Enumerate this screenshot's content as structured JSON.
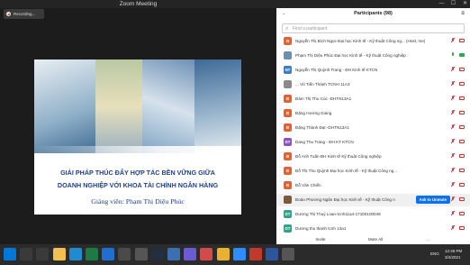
{
  "window": {
    "title": "Zoom Meeting",
    "min": "—",
    "max": "☐",
    "close": "✕"
  },
  "recording": {
    "label": "Recording..."
  },
  "slide": {
    "line1": "GIẢI PHÁP THÚC ĐẨY HỢP TÁC BỀN VỮNG GIỮA",
    "line2": "DOANH NGHIỆP VỚI KHOA TÀI CHÍNH NGÂN HÀNG",
    "lecturer": "Giảng viên: Phạm Thị Diệu Phúc"
  },
  "participants": {
    "title": "Participants (98)",
    "search_placeholder": "Find a participant",
    "rows": [
      {
        "initials": "N",
        "color": "#e8602c",
        "name": "Nguyễn Thị Bích Ngọc Đại học Kinh tế - Kỹ thuật Công ng... (Host, me)",
        "mic": "muted",
        "cam": "off"
      },
      {
        "initials": "",
        "color": "#6c8fb3",
        "name": "Phạm Thị Diệu Phúc Đại học Kinh tế - Kỹ thuật Công nghiệp",
        "mic": "on",
        "cam": "on"
      },
      {
        "initials": "NT",
        "color": "#3d7cc9",
        "name": "Nguyễn Thị Quỳnh Trang - ĐH Kinh tế KTCN",
        "mic": "muted",
        "cam": "off"
      },
      {
        "initials": "",
        "color": "#8a8a8a",
        "name": "... Vũ Tiến Thành TCNH 11A3",
        "mic": "muted",
        "cam": "off"
      },
      {
        "initials": "Đ",
        "color": "#e8602c",
        "name": "Đàm Thị Thu Cúc -DHTN13A1",
        "mic": "muted",
        "cam": "off"
      },
      {
        "initials": "Đ",
        "color": "#e8602c",
        "name": "Đặng Hương Giang",
        "mic": "muted",
        "cam": "off"
      },
      {
        "initials": "Đ",
        "color": "#e8602c",
        "name": "Đặng Thành Đạt -DHTN13A1",
        "mic": "muted",
        "cam": "off"
      },
      {
        "initials": "DT",
        "color": "#8e4fc4",
        "name": "Dang Thu Trang - ĐH KT KTCN",
        "mic": "muted",
        "cam": "off"
      },
      {
        "initials": "Đ",
        "color": "#e8602c",
        "name": "Đỗ Anh Tuấn ĐH Kinh tế Kỹ thuật Công nghiệp",
        "mic": "muted",
        "cam": "off"
      },
      {
        "initials": "Đ",
        "color": "#e8602c",
        "name": "Đỗ Thị Thu Quỳnh Đại học Kinh tế - Kỹ thuật Công ng...",
        "mic": "muted",
        "cam": "off"
      },
      {
        "initials": "Đ",
        "color": "#e8602c",
        "name": "Đỗ Văn Chiến",
        "mic": "muted",
        "cam": "off"
      },
      {
        "initials": "",
        "color": "#7a5a3a",
        "name": "Đoàn Phương Ngân Đại học Kinh tế - Kỹ thuật Công n",
        "mic": "muted",
        "cam": "off",
        "unmute": "Ask to Unmute"
      },
      {
        "initials": "DT",
        "color": "#2aa58a",
        "name": "Dương Thị Thuý Loan-tcnh11a4-17100100049",
        "mic": "muted",
        "cam": "off"
      },
      {
        "initials": "DT",
        "color": "#2aa58a",
        "name": "Dương thu thanh tcnh 13a1",
        "mic": "muted",
        "cam": "off"
      }
    ],
    "footer": {
      "invite": "Invite",
      "mute_all": "Mute All",
      "more": "..."
    }
  },
  "taskbar": {
    "apps": [
      {
        "icon": "windows-icon",
        "color": "#0078d7"
      },
      {
        "icon": "search-icon",
        "color": "#3a3a3a"
      },
      {
        "icon": "task-view-icon",
        "color": "#3a3a3a"
      },
      {
        "icon": "file-explorer-icon",
        "color": "#f3c04f"
      },
      {
        "icon": "edge-icon",
        "color": "#1f8bd0"
      },
      {
        "icon": "excel-icon",
        "color": "#1d7a45"
      },
      {
        "icon": "mail-icon",
        "color": "#1f6fd0"
      },
      {
        "icon": "photos-icon",
        "color": "#4a4a4a"
      },
      {
        "icon": "settings-icon",
        "color": "#555555"
      },
      {
        "icon": "amazon-icon",
        "color": "#232f3e"
      },
      {
        "icon": "store-icon",
        "color": "#3a6fb0"
      },
      {
        "icon": "app-icon",
        "color": "#6b5bd2"
      },
      {
        "icon": "app2-icon",
        "color": "#d24b4b"
      },
      {
        "icon": "chrome-icon",
        "color": "#e8b22e"
      },
      {
        "icon": "zoom-icon",
        "color": "#2d8cff"
      },
      {
        "icon": "app3-icon",
        "color": "#c0392b"
      },
      {
        "icon": "word-icon",
        "color": "#2b579a"
      },
      {
        "icon": "app4-icon",
        "color": "#555555"
      }
    ],
    "lang": "ENG",
    "time": "12:46 PM",
    "date": "3/4/2021"
  }
}
